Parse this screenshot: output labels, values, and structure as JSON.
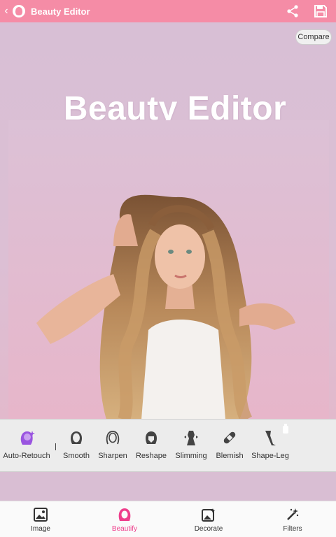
{
  "header": {
    "title": "Beauty Editor"
  },
  "canvas": {
    "compare_label": "Compare",
    "headline": "Beauty Editor"
  },
  "tools": [
    {
      "label": "Auto-Retouch",
      "icon": "auto-retouch-icon"
    },
    {
      "label": "Smooth",
      "icon": "smooth-face-icon"
    },
    {
      "label": "Sharpen",
      "icon": "sharpen-face-icon"
    },
    {
      "label": "Reshape",
      "icon": "reshape-face-icon"
    },
    {
      "label": "Slimming",
      "icon": "slimming-icon"
    },
    {
      "label": "Blemish",
      "icon": "bandage-icon"
    },
    {
      "label": "Shape-Leg",
      "icon": "leg-icon"
    }
  ],
  "nav": [
    {
      "label": "Image",
      "icon": "image-icon"
    },
    {
      "label": "Beautify",
      "icon": "beautify-icon",
      "active": true
    },
    {
      "label": "Decorate",
      "icon": "decorate-icon"
    },
    {
      "label": "Filters",
      "icon": "magic-wand-icon"
    }
  ],
  "colors": {
    "header": "#f58ca6",
    "accent": "#ee3d8b",
    "auto_retouch": "#9a55e0"
  }
}
